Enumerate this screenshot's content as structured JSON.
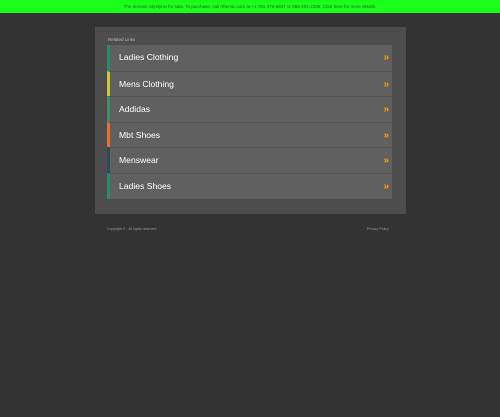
{
  "top_banner": {
    "text": "The domain citystyl.ie for sale. To purchase, call Afternic.com at +1 781-373-6847 or 855-201-2286. Click here for more details."
  },
  "panel": {
    "title": "Related Links",
    "links": [
      {
        "label": "Ladies Clothing",
        "accent": "#2b8a6b",
        "icon": "double-chevron-right-icon"
      },
      {
        "label": "Mens Clothing",
        "accent": "#c9c83a",
        "icon": "double-chevron-right-icon"
      },
      {
        "label": "Addidas",
        "accent": "#3f8f6b",
        "icon": "double-chevron-right-icon"
      },
      {
        "label": "Mbt Shoes",
        "accent": "#e5702a",
        "icon": "double-chevron-right-icon"
      },
      {
        "label": "Menswear",
        "accent": "#2d4a5a",
        "icon": "double-chevron-right-icon"
      },
      {
        "label": "Ladies Shoes",
        "accent": "#2b8a6b",
        "icon": "double-chevron-right-icon"
      }
    ]
  },
  "footer": {
    "copyright": "Copyright © . All rights reserved.",
    "privacy": "Privacy Policy"
  },
  "colors": {
    "banner_bg": "#1aff1a",
    "page_bg": "#333333",
    "panel_bg": "#4d4d4d",
    "row_bg": "#606060",
    "chevron": "#f39c12"
  }
}
